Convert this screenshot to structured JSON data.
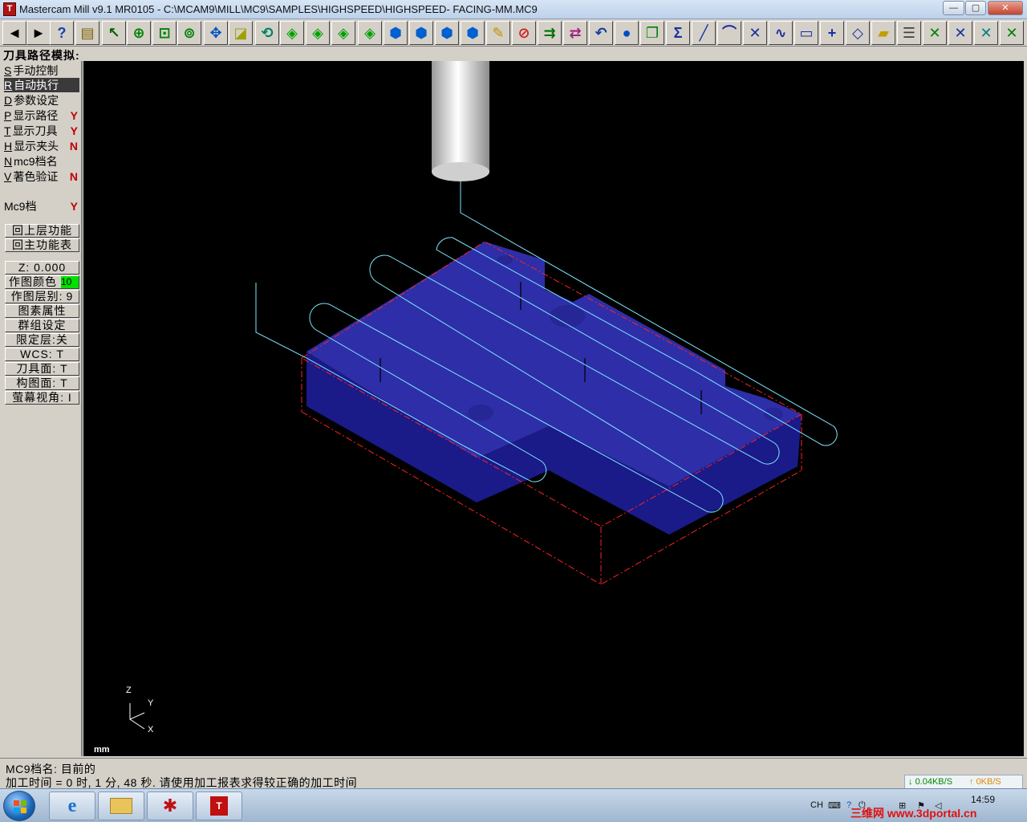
{
  "window": {
    "title": "Mastercam Mill v9.1 MR0105 - C:\\MCAM9\\MILL\\MC9\\SAMPLES\\HIGHSPEED\\HIGHSPEED- FACING-MM.MC9",
    "icon_letter": "T",
    "minimize": "—",
    "maximize": "▢",
    "close": "✕"
  },
  "toolbar": {
    "buttons": [
      {
        "icon": "arrow-left-icon",
        "glyph": "◄",
        "color": "#000000"
      },
      {
        "icon": "arrow-right-icon",
        "glyph": "►",
        "color": "#000000"
      },
      {
        "icon": "help-icon",
        "glyph": "?",
        "color": "#1a3fb0"
      },
      {
        "icon": "calculator-icon",
        "glyph": "▤",
        "color": "#806000"
      },
      {
        "icon": "analyze-icon",
        "glyph": "↖",
        "color": "#006000"
      },
      {
        "icon": "zoom-icon",
        "glyph": "⊕",
        "color": "#008000"
      },
      {
        "icon": "zoom-window-icon",
        "glyph": "⊡",
        "color": "#008000"
      },
      {
        "icon": "zoom-fit-icon",
        "glyph": "⊚",
        "color": "#008000"
      },
      {
        "icon": "pan-icon",
        "glyph": "✥",
        "color": "#0050c0"
      },
      {
        "icon": "select-window-icon",
        "glyph": "◪",
        "color": "#a0a000"
      },
      {
        "icon": "dynamic-rotate-icon",
        "glyph": "⟲",
        "color": "#008060"
      },
      {
        "icon": "view-top-icon",
        "glyph": "◈",
        "color": "#00a000"
      },
      {
        "icon": "view-front-icon",
        "glyph": "◈",
        "color": "#00a000"
      },
      {
        "icon": "view-side-icon",
        "glyph": "◈",
        "color": "#00a000"
      },
      {
        "icon": "view-iso-icon",
        "glyph": "◈",
        "color": "#00a000"
      },
      {
        "icon": "cplane-top-icon",
        "glyph": "⬢",
        "color": "#0060d0"
      },
      {
        "icon": "cplane-front-icon",
        "glyph": "⬢",
        "color": "#0060d0"
      },
      {
        "icon": "cplane-side-icon",
        "glyph": "⬢",
        "color": "#0060d0"
      },
      {
        "icon": "cplane-3d-icon",
        "glyph": "⬢",
        "color": "#0060d0"
      },
      {
        "icon": "eraser-icon",
        "glyph": "✎",
        "color": "#c09000"
      },
      {
        "icon": "delete-icon",
        "glyph": "⊘",
        "color": "#d02020"
      },
      {
        "icon": "transform-icon",
        "glyph": "⇉",
        "color": "#007000"
      },
      {
        "icon": "translate-icon",
        "glyph": "⇄",
        "color": "#a02080"
      },
      {
        "icon": "undo-icon",
        "glyph": "↶",
        "color": "#1040a0"
      },
      {
        "icon": "sphere-icon",
        "glyph": "●",
        "color": "#0050c0"
      },
      {
        "icon": "copy-icon",
        "glyph": "❐",
        "color": "#008000"
      },
      {
        "icon": "sigma-icon",
        "glyph": "Σ",
        "color": "#1a2fa0"
      },
      {
        "icon": "line-icon",
        "glyph": "╱",
        "color": "#1a2fa0"
      },
      {
        "icon": "arc-icon",
        "glyph": "⌒",
        "color": "#1a2fa0"
      },
      {
        "icon": "fillet-icon",
        "glyph": "✕",
        "color": "#1a2fa0"
      },
      {
        "icon": "spline-icon",
        "glyph": "∿",
        "color": "#1a2fa0"
      },
      {
        "icon": "rectangle-icon",
        "glyph": "▭",
        "color": "#1a2fa0"
      },
      {
        "icon": "point-icon",
        "glyph": "+",
        "color": "#1a2fa0"
      },
      {
        "icon": "surface-icon",
        "glyph": "◇",
        "color": "#1a2fa0"
      },
      {
        "icon": "solid-icon",
        "glyph": "▰",
        "color": "#c0a000"
      },
      {
        "icon": "operations-icon",
        "glyph": "☰",
        "color": "#404040"
      },
      {
        "icon": "trim-icon",
        "glyph": "✕",
        "color": "#008000"
      },
      {
        "icon": "trim-two-icon",
        "glyph": "✕",
        "color": "#1a2fa0"
      },
      {
        "icon": "break-icon",
        "glyph": "✕",
        "color": "#008080"
      },
      {
        "icon": "join-icon",
        "glyph": "✕",
        "color": "#008000"
      }
    ]
  },
  "prompt": "刀具路径模拟:",
  "menu": {
    "items": [
      {
        "hotkey": "S",
        "label": "手动控制",
        "value": ""
      },
      {
        "hotkey": "R",
        "label": "自动执行",
        "value": ""
      },
      {
        "hotkey": "D",
        "label": "参数设定",
        "value": ""
      },
      {
        "hotkey": "P",
        "label": "显示路径",
        "value": "Y"
      },
      {
        "hotkey": "T",
        "label": "显示刀具",
        "value": "Y"
      },
      {
        "hotkey": "H",
        "label": "显示夹头",
        "value": "N"
      },
      {
        "hotkey": "N",
        "label": "mc9档名",
        "value": ""
      },
      {
        "hotkey": "V",
        "label": "著色验证",
        "value": "N"
      }
    ],
    "mc9": {
      "label": "Mc9档",
      "value": "Y"
    },
    "nav": {
      "back": "回上层功能",
      "main": "回主功能表"
    },
    "secondary": {
      "z": "Z:  0.000",
      "color": {
        "label": "作图颜色",
        "value": "10"
      },
      "level": {
        "label": "作图层别:",
        "value": "9"
      },
      "attributes": "图素属性",
      "groups": "群组设定",
      "mask": "限定层:关",
      "wcs": "WCS:  T",
      "tplane": "刀具面:  T",
      "cplane": "构图面:  T",
      "gview": "萤幕视角:  I"
    }
  },
  "viewport": {
    "background": "#000000",
    "part_color": "#2e2ea8",
    "toolpath_color": "#7fe8ff",
    "stock_color": "#ff2020",
    "tool_color": "#e8e8e8",
    "axis": {
      "z": "Z",
      "y": "Y",
      "x": "X"
    },
    "unit": "mm"
  },
  "status": {
    "line1": "MC9档名: 目前的",
    "line2": "加工时间 = 0 时, 1 分, 48 秒. 请使用加工报表求得较正确的加工时间",
    "download": "0.04KB/S",
    "upload": "0KB/S"
  },
  "taskbar": {
    "tray_lang": "CH",
    "clock": "14:59",
    "watermark": "三维网 www.3dportal.cn"
  }
}
